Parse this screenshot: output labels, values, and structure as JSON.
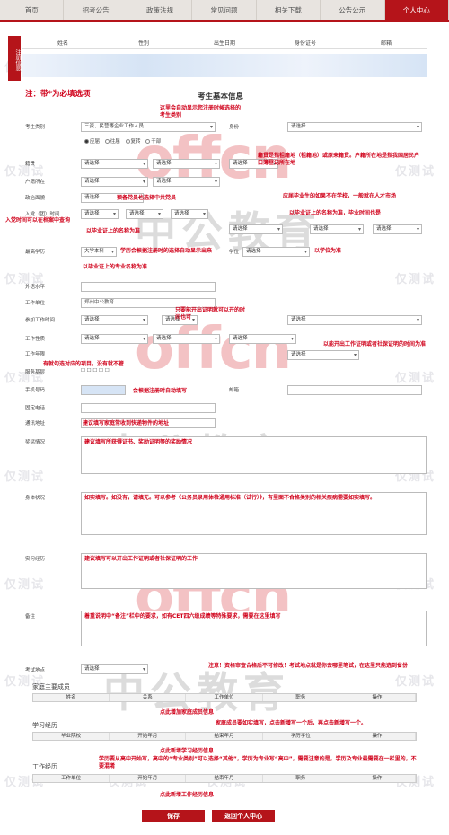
{
  "nav": [
    "首页",
    "招考公告",
    "政策法规",
    "常见问题",
    "相关下载",
    "公告公示",
    "个人中心"
  ],
  "side_label": "注册信息",
  "members_cols": [
    "姓名",
    "性别",
    "出生日期",
    "身份证号",
    "邮箱"
  ],
  "watermark": "仅测试",
  "logo": {
    "en": "offcn",
    "cn": "中公教育"
  },
  "heading_note": "注：带*为必填选项",
  "heading_title": "考生基本信息",
  "labels": {
    "exam_cat": "考生类别",
    "identity": "身份",
    "native": "籍贯",
    "hukou": "户籍所在",
    "politics": "政治面貌",
    "party_date": "入党（团）时间",
    "degree_edu": "最高学历",
    "degree": "学位",
    "foreign": "外语水平",
    "work_unit": "工作单位",
    "join_work": "参加工作时间",
    "work_nature": "工作性质",
    "work_years": "工作年限",
    "service": "服务基层",
    "phone": "手机号码",
    "phone2": "固定电话",
    "email": "邮箱",
    "address": "通讯地址",
    "awards": "奖惩情况",
    "health": "身体状况",
    "practice": "实习经历",
    "remark": "备注",
    "exam_place": "考试地点",
    "family": "家庭主要成员",
    "study": "学习经历",
    "work": "工作经历"
  },
  "select_default": "请选择",
  "exam_cat_value": "三资、民营等企业工作人员",
  "radio_opts": [
    "应届",
    "往届",
    "复转",
    "干部"
  ],
  "date_parts": [
    "年",
    "月",
    "日"
  ],
  "degree_value": "大学本科",
  "work_unit_value": "郑州中公教育",
  "notes": {
    "n1": "这里会自动显示您注册时候选择的考生类别",
    "n2": "预备党员也选择中共党员",
    "n3": "以毕业证上的名称为准",
    "n4": "学历会根据注册时的选择自动显示出来",
    "n5": "以毕业证上的专业名称为准",
    "n6": "籍贯是指祖籍地（祖籍地）或原来籍贯。户籍所在地是指我国居民户口簿登记所在地",
    "n7": "应届毕业生的如果不在学校，一般就在人才市场",
    "n8": "以毕业证上的名称为准，毕业时间也是",
    "n9": "以学位为准",
    "n10": "只要能开出证明就可以开的时间也可",
    "n11": "以能开出工作证明或者社保证明的时间为准",
    "n12": "有就勾选对应的项目，没有就不管",
    "n13": "会根据注册时自动填写",
    "n14": "入党时间可以在档案中查询",
    "n15": "建议填写家庭常收到快递物件的地址",
    "n16": "建议填写所获得证书、奖励证明等的奖励情况",
    "n17": "如实填写。如没有，请填无。可以参考《公务员录用体检通用标准（试行）》，有里面不合格类别的相关疾病需要如实填写。",
    "n18": "建议填写可以开出工作证明或者社保证明的工作",
    "n19": "着重说明中“备注”栏中的要求，如有CET四六级成绩等特殊要求，需要在这里填写",
    "n20": "注意！资格审查合格后不可修改！考试地点就是你去哪里笔试，在这里只能选到省份",
    "n21": "点此增加家庭成员信息",
    "n22": "家庭成员要如实填写，点击新增写一个后，再点击新增写一个。",
    "n23": "点此新增学习经历信息",
    "n24": "学历要从高中开始写，高中的“专业类别”可以选择“其他”，学历为专业写“高中”，需要注意的是，学历及专业最需要在一栏里的，不要混淆",
    "n25": "点此新增工作经历信息"
  },
  "family_cols": [
    "姓名",
    "关系",
    "工作单位",
    "职务",
    "操作"
  ],
  "study_cols": [
    "毕业院校",
    "开始年月",
    "结束年月",
    "学历学位",
    "操作"
  ],
  "work_cols": [
    "工作单位",
    "开始年月",
    "结束年月",
    "职务",
    "操作"
  ],
  "buttons": {
    "save": "保存",
    "back": "返回个人中心"
  }
}
